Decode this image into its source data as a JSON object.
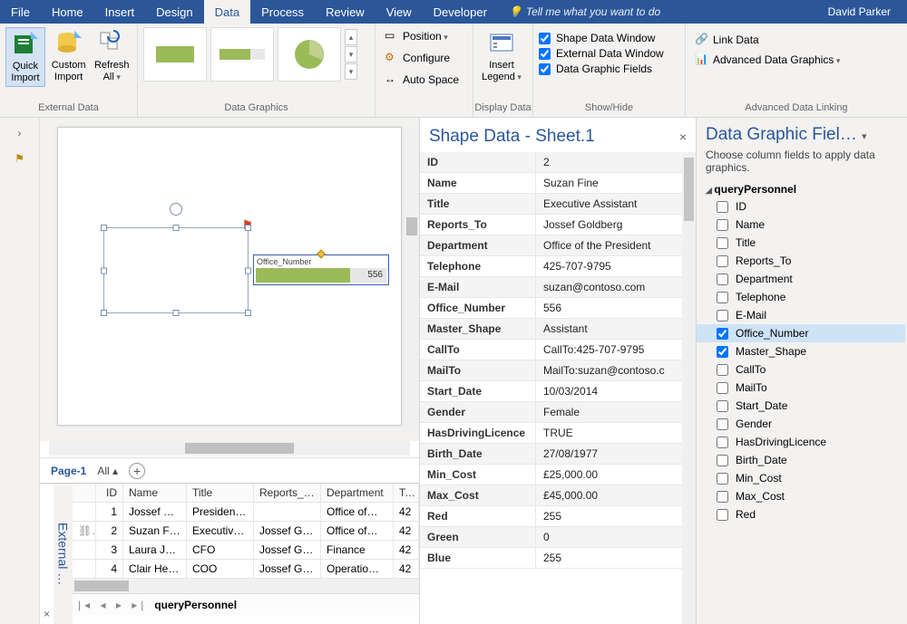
{
  "menubar": {
    "items": [
      "File",
      "Home",
      "Insert",
      "Design",
      "Data",
      "Process",
      "Review",
      "View",
      "Developer"
    ],
    "active_index": 4,
    "tellme": "Tell me what you want to do",
    "user": "David Parker"
  },
  "ribbon": {
    "external_data": {
      "label": "External Data",
      "quick_import": "Quick Import",
      "custom_import": "Custom Import",
      "refresh_all": "Refresh All"
    },
    "data_graphics": {
      "label": "Data Graphics"
    },
    "position": "Position",
    "configure": "Configure",
    "auto_space": "Auto Space",
    "display_data": {
      "label": "Display Data",
      "insert_legend": "Insert Legend"
    },
    "show_hide": {
      "label": "Show/Hide",
      "shape_data_window": "Shape Data Window",
      "external_data_window": "External Data Window",
      "data_graphic_fields": "Data Graphic Fields"
    },
    "adv": {
      "label": "Advanced Data Linking",
      "link_data": "Link Data",
      "adv_graphics": "Advanced Data Graphics"
    }
  },
  "canvas": {
    "callout_label": "Office_Number",
    "callout_value": "556"
  },
  "page_tabs": {
    "page1": "Page-1",
    "all": "All"
  },
  "ext": {
    "title": "External …",
    "status_source": "queryPersonnel",
    "headers": {
      "id": "ID",
      "name": "Name",
      "title": "Title",
      "reports": "Reports_To",
      "dept": "Department",
      "tel": "Tel"
    },
    "rows": [
      {
        "link": "",
        "id": "1",
        "name": "Jossef G…",
        "title": "Presiden…",
        "reports": "",
        "dept": "Office of…",
        "tel": "42"
      },
      {
        "link": "⛓",
        "id": "2",
        "name": "Suzan Fi…",
        "title": "Executiv…",
        "reports": "Jossef G…",
        "dept": "Office of…",
        "tel": "42"
      },
      {
        "link": "",
        "id": "3",
        "name": "Laura Je…",
        "title": "CFO",
        "reports": "Jossef G…",
        "dept": "Finance",
        "tel": "42"
      },
      {
        "link": "",
        "id": "4",
        "name": "Clair Hec…",
        "title": "COO",
        "reports": "Jossef G…",
        "dept": "Operatio…",
        "tel": "42"
      }
    ]
  },
  "shape_data": {
    "title": "Shape Data - Sheet.1",
    "rows": [
      {
        "k": "ID",
        "v": "2"
      },
      {
        "k": "Name",
        "v": "Suzan Fine"
      },
      {
        "k": "Title",
        "v": "Executive Assistant"
      },
      {
        "k": "Reports_To",
        "v": "Jossef Goldberg"
      },
      {
        "k": "Department",
        "v": "Office of the President"
      },
      {
        "k": "Telephone",
        "v": "425-707-9795"
      },
      {
        "k": "E-Mail",
        "v": "suzan@contoso.com"
      },
      {
        "k": "Office_Number",
        "v": "556"
      },
      {
        "k": "Master_Shape",
        "v": "Assistant"
      },
      {
        "k": "CallTo",
        "v": "CallTo:425-707-9795"
      },
      {
        "k": "MailTo",
        "v": "MailTo:suzan@contoso.c"
      },
      {
        "k": "Start_Date",
        "v": "10/03/2014"
      },
      {
        "k": "Gender",
        "v": "Female"
      },
      {
        "k": "HasDrivingLicence",
        "v": "TRUE"
      },
      {
        "k": "Birth_Date",
        "v": "27/08/1977"
      },
      {
        "k": "Min_Cost",
        "v": "£25,000.00"
      },
      {
        "k": "Max_Cost",
        "v": "£45,000.00"
      },
      {
        "k": "Red",
        "v": "255"
      },
      {
        "k": "Green",
        "v": "0"
      },
      {
        "k": "Blue",
        "v": "255"
      }
    ]
  },
  "dgf": {
    "title": "Data Graphic Fiel…",
    "desc": "Choose column fields to apply data graphics.",
    "group": "queryPersonnel",
    "fields": [
      {
        "name": "ID",
        "checked": false
      },
      {
        "name": "Name",
        "checked": false
      },
      {
        "name": "Title",
        "checked": false
      },
      {
        "name": "Reports_To",
        "checked": false
      },
      {
        "name": "Department",
        "checked": false
      },
      {
        "name": "Telephone",
        "checked": false
      },
      {
        "name": "E-Mail",
        "checked": false
      },
      {
        "name": "Office_Number",
        "checked": true,
        "selected": true
      },
      {
        "name": "Master_Shape",
        "checked": true
      },
      {
        "name": "CallTo",
        "checked": false
      },
      {
        "name": "MailTo",
        "checked": false
      },
      {
        "name": "Start_Date",
        "checked": false
      },
      {
        "name": "Gender",
        "checked": false
      },
      {
        "name": "HasDrivingLicence",
        "checked": false
      },
      {
        "name": "Birth_Date",
        "checked": false
      },
      {
        "name": "Min_Cost",
        "checked": false
      },
      {
        "name": "Max_Cost",
        "checked": false
      },
      {
        "name": "Red",
        "checked": false
      }
    ]
  }
}
